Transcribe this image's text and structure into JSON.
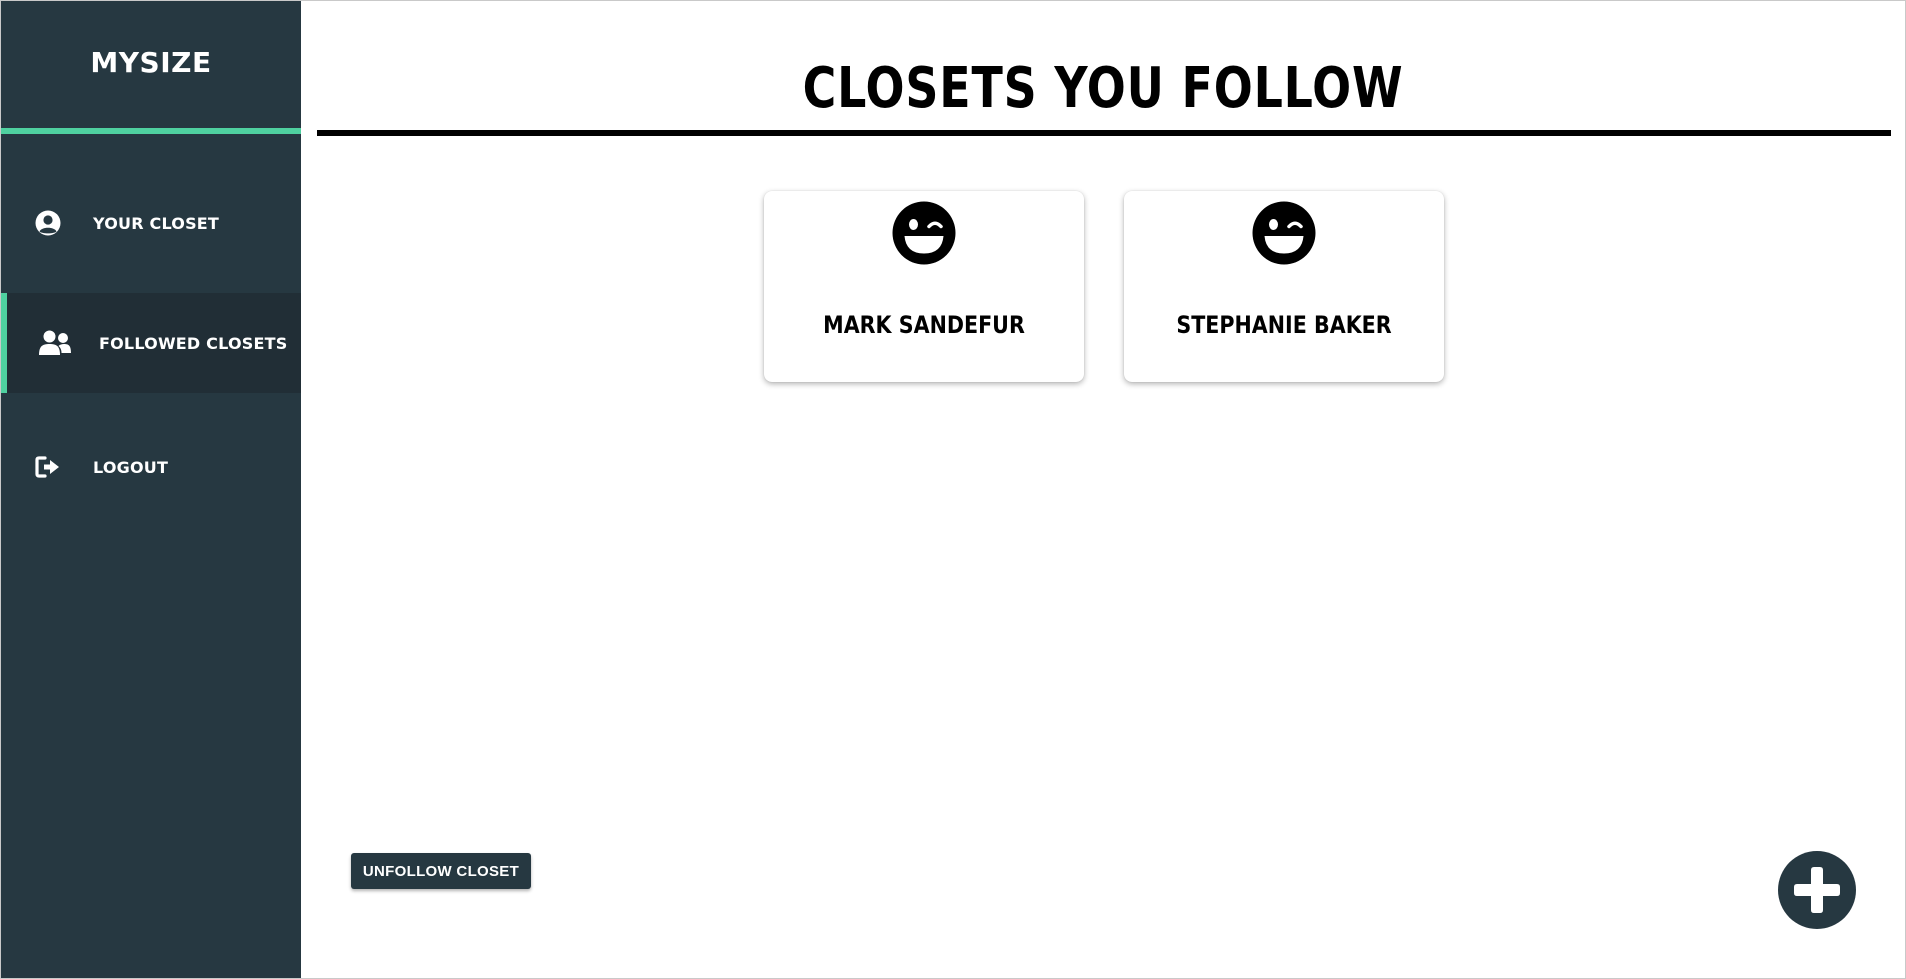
{
  "app": {
    "brand": "MYSIZE"
  },
  "sidebar": {
    "items": [
      {
        "label": "YOUR CLOSET",
        "icon": "user-circle-icon",
        "active": false
      },
      {
        "label": "FOLLOWED CLOSETS",
        "icon": "users-icon",
        "active": true
      },
      {
        "label": "LOGOUT",
        "icon": "sign-out-icon",
        "active": false
      }
    ]
  },
  "main": {
    "title": "CLOSETS YOU FOLLOW",
    "closets": [
      {
        "name": "MARK SANDEFUR",
        "icon": "grin-wink-icon"
      },
      {
        "name": "STEPHANIE BAKER",
        "icon": "grin-wink-icon"
      }
    ],
    "unfollow_label": "UNFOLLOW CLOSET",
    "fab_icon": "plus-icon"
  },
  "colors": {
    "sidebar_bg": "#263841",
    "sidebar_active_bg": "#212e36",
    "accent": "#4fd1a0",
    "button_bg": "#263841"
  }
}
